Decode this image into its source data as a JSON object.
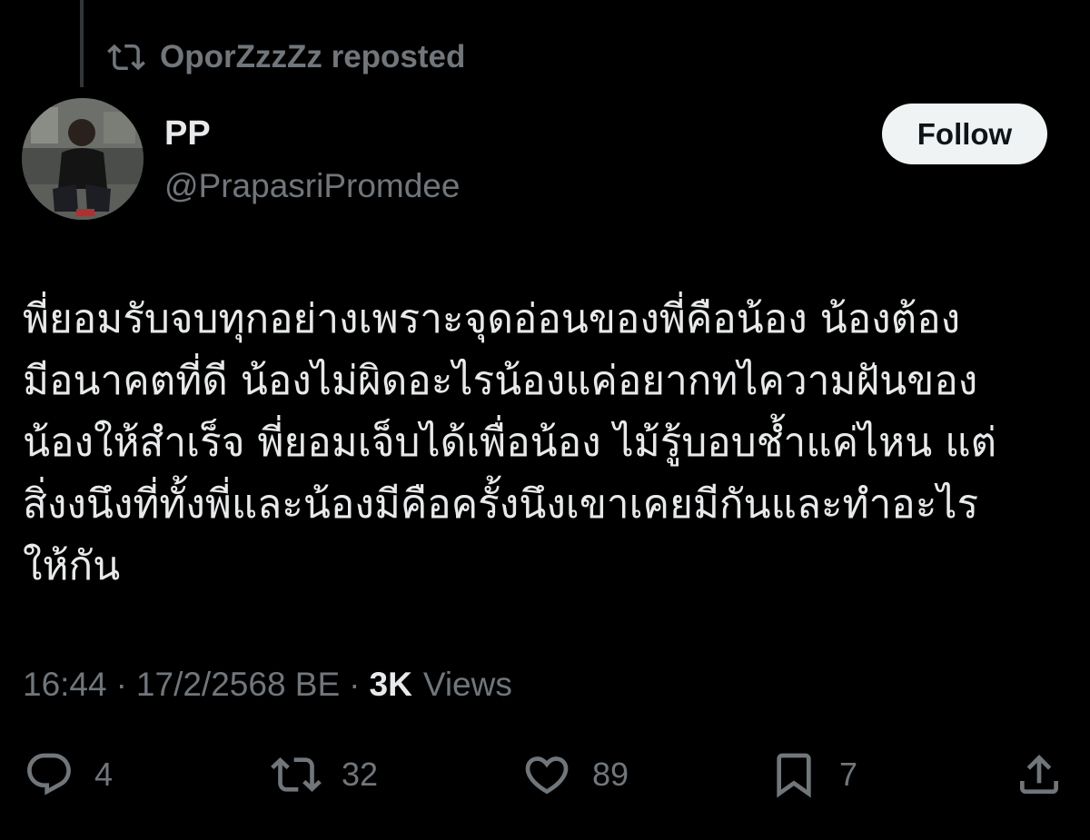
{
  "repost": {
    "icon": "repost-icon",
    "text": "OporZzzZz reposted"
  },
  "author": {
    "avatar": "profile-photo",
    "display_name": "PP",
    "handle": "@PrapasriPromdee"
  },
  "follow_label": "Follow",
  "tweet": {
    "text": "พี่ยอมรับจบทุกอย่างเพราะจุดอ่อนของพี่คือน้อง น้องต้อง\nมีอนาคตที่ดี น้องไม่ผิดอะไรน้องแค่อยากทไความฝันของ\nน้องให้สำเร็จ พี่ยอมเจ็บได้เพื่อน้อง ไม้รู้บอบช้ำแค่ไหน แต่\nสิ่งงนึงที่ทั้งพี่และน้องมีคือครั้งนึงเขาเคยมีกันและทำอะไร\nให้กัน"
  },
  "meta": {
    "time": "16:44",
    "separator": "·",
    "date": "17/2/2568 BE",
    "views_count": "3K",
    "views_label": "Views"
  },
  "actions": {
    "reply": {
      "icon": "reply-icon",
      "count": "4"
    },
    "repost": {
      "icon": "repost-icon",
      "count": "32"
    },
    "like": {
      "icon": "heart-icon",
      "count": "89"
    },
    "bookmark": {
      "icon": "bookmark-icon",
      "count": "7"
    },
    "share": {
      "icon": "share-icon"
    }
  },
  "colors": {
    "background": "#000000",
    "primary_text": "#e7e9ea",
    "secondary_text": "#71767b",
    "follow_button_bg": "#eff3f4",
    "follow_button_text": "#0f1419"
  }
}
